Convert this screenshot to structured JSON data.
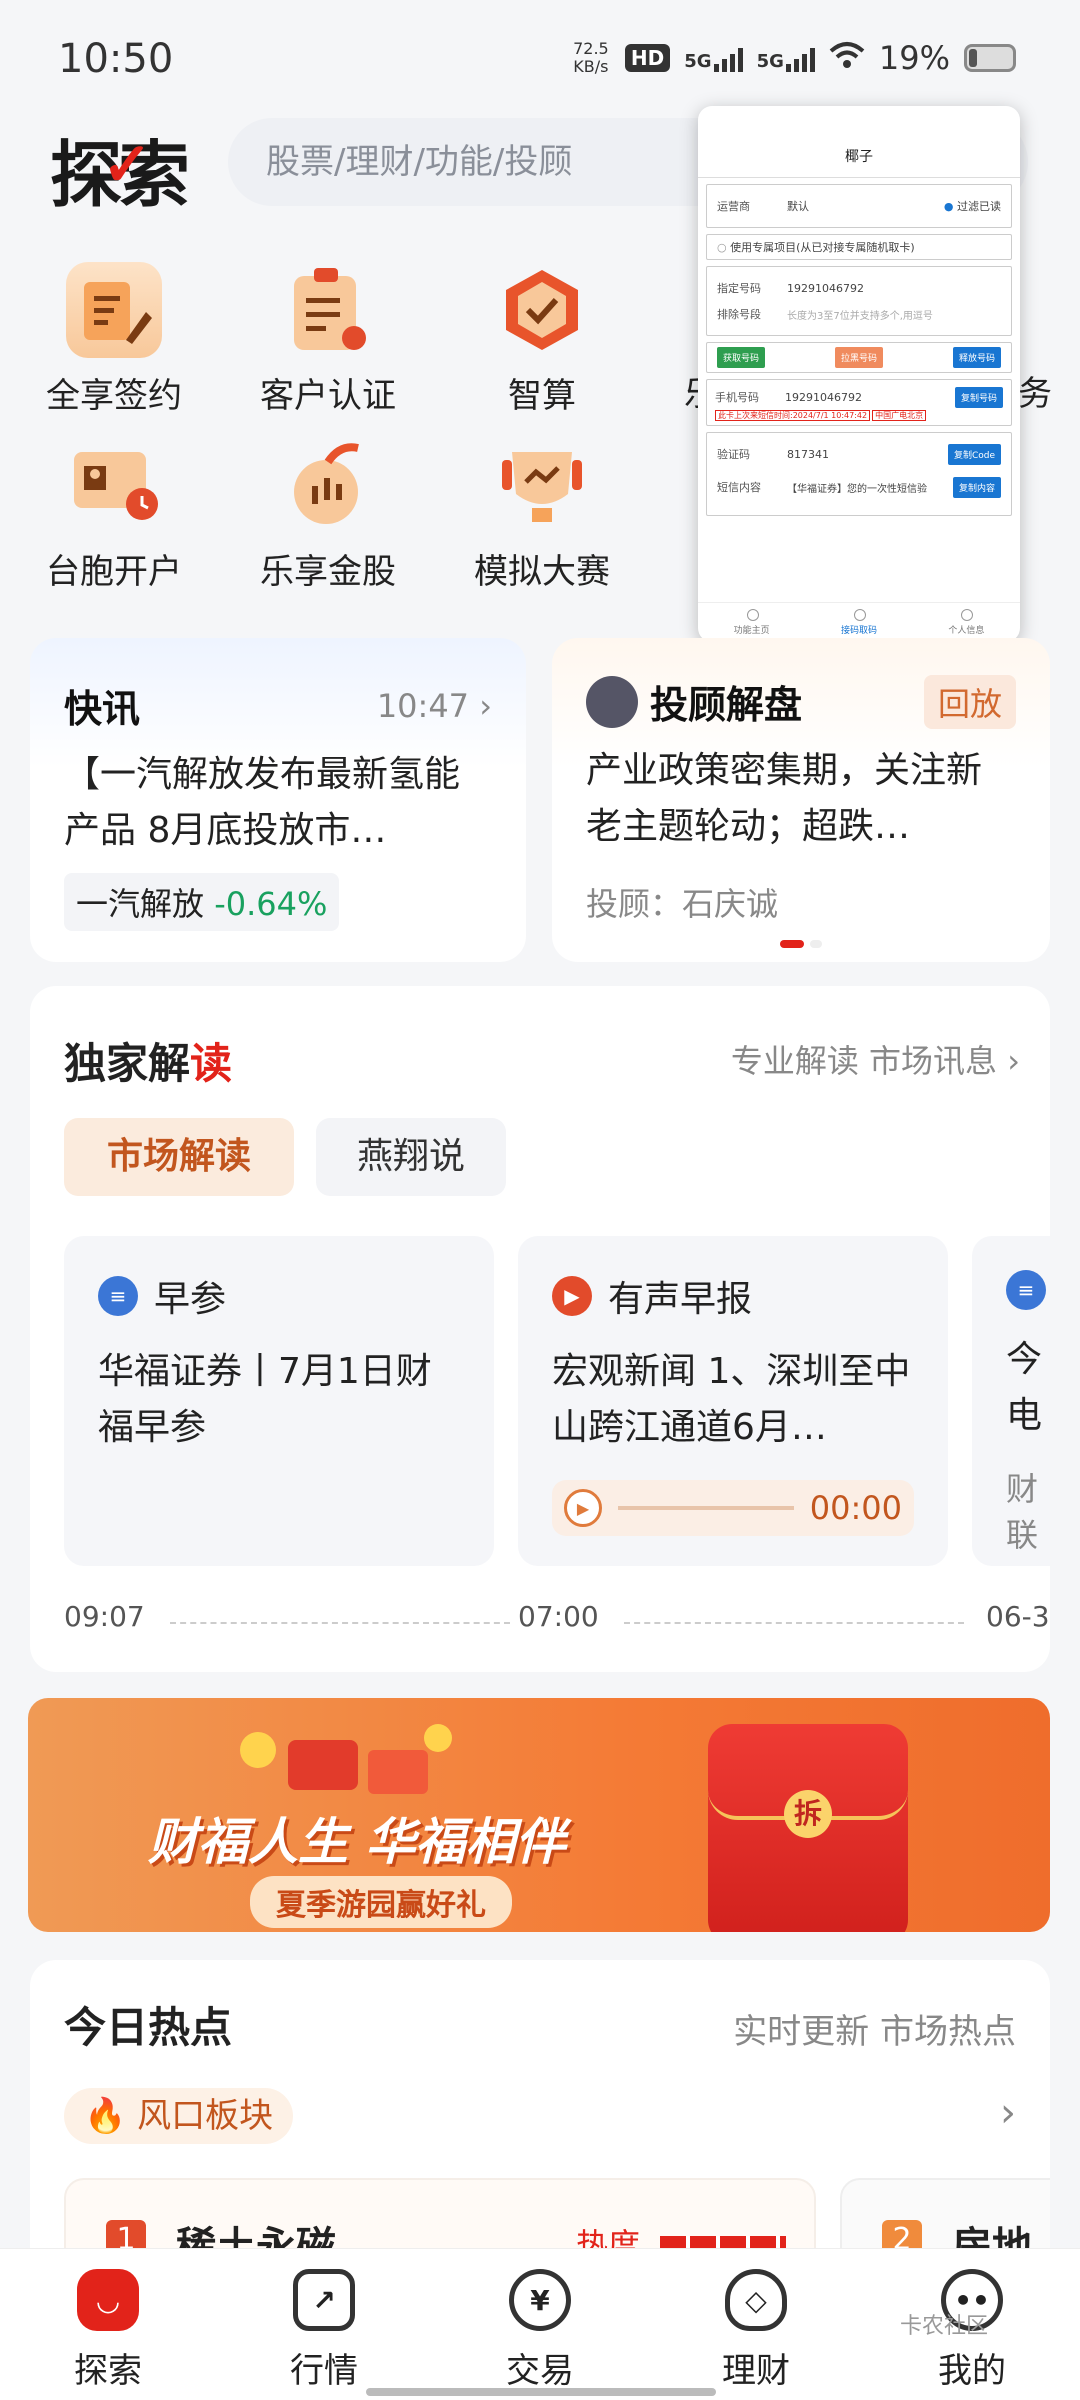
{
  "status_bar": {
    "time": "10:50",
    "net_speed_value": "72.5",
    "net_speed_unit": "KB/s",
    "hd_label": "HD",
    "sim1": "5G",
    "sim2": "5G",
    "battery": "19%"
  },
  "header": {
    "logo": "探索",
    "search_placeholder": "股票/理财/功能/投顾"
  },
  "quick_grid": [
    {
      "label": "全享签约",
      "icon": "contract-icon"
    },
    {
      "label": "客户认证",
      "icon": "clipboard-icon"
    },
    {
      "label": "智算",
      "icon": "shield-check-icon"
    },
    {
      "label": "乐",
      "icon": "hidden-icon"
    },
    {
      "label": "务",
      "icon": "hidden-icon"
    },
    {
      "label": "台胞开户",
      "icon": "id-card-icon"
    },
    {
      "label": "乐享金股",
      "icon": "gold-stock-icon"
    },
    {
      "label": "模拟大赛",
      "icon": "trophy-icon"
    }
  ],
  "overlay": {
    "title": "椰子",
    "carrier_label": "运营商",
    "carrier_value": "默认",
    "filter_label": "过滤已读",
    "exclusive_option": "使用专属项目(从已对接专属随机取卡)",
    "specified_label": "指定号码",
    "specified_value": "19291046792",
    "exclude_label": "排除号段",
    "exclude_placeholder": "长度为3至7位并支持多个,用逗号",
    "btn_get": "获取号码",
    "btn_blacklist": "拉黑号码",
    "btn_release": "释放号码",
    "phone_label": "手机号码",
    "phone_value": "19291046792",
    "btn_copy_phone": "复制号码",
    "last_sms_note": "此卡上次来短信时间:2024/7/1 10:47:42",
    "carrier_tag": "中国广电北京",
    "code_label": "验证码",
    "code_value": "817341",
    "btn_copy_code": "复制Code",
    "sms_label": "短信内容",
    "sms_value": "【华福证券】您的一次性短信验",
    "btn_copy_sms": "复制内容",
    "tabs": [
      "功能主页",
      "接码取码",
      "个人信息"
    ]
  },
  "news_card": {
    "title": "快讯",
    "time": "10:47",
    "body": "【一汽解放发布最新氢能产品 8月底投放市…",
    "stock_name": "一汽解放",
    "stock_change": "-0.64%"
  },
  "advisor_card": {
    "title": "投顾解盘",
    "badge": "回放",
    "body": "产业政策密集期，关注新老主题轮动；超跌…",
    "advisor_label": "投顾：",
    "advisor_name": "石庆诚"
  },
  "exclusive": {
    "title_prefix": "独家解",
    "title_suffix": "读",
    "subtitle": "专业解读 市场讯息",
    "tabs": [
      "市场解读",
      "燕翔说"
    ],
    "cards": [
      {
        "tag": "早参",
        "body": "华福证券丨7月1日财福早参",
        "time": "09:07"
      },
      {
        "tag": "有声早报",
        "body": "宏观新闻 1、深圳至中山跨江通道6月…",
        "audio_time": "00:00",
        "time": "07:00"
      },
      {
        "tag": "",
        "body": "今电",
        "source": "财联",
        "time": "06-3"
      }
    ]
  },
  "banner": {
    "headline": "财福人生 华福相伴",
    "sub": "夏季游园赢好礼",
    "envelope_char": "拆"
  },
  "hot": {
    "title": "今日热点",
    "subtitle": "实时更新 市场热点",
    "pill": "风口板块",
    "items": [
      {
        "rank": "1",
        "name": "稀土永磁",
        "heat_label": "热度"
      },
      {
        "rank": "2",
        "name": "房地"
      }
    ]
  },
  "bottom_nav": [
    {
      "label": "探索",
      "active": true
    },
    {
      "label": "行情"
    },
    {
      "label": "交易"
    },
    {
      "label": "理财"
    },
    {
      "label": "我的"
    }
  ],
  "watermark": "卡农社区"
}
